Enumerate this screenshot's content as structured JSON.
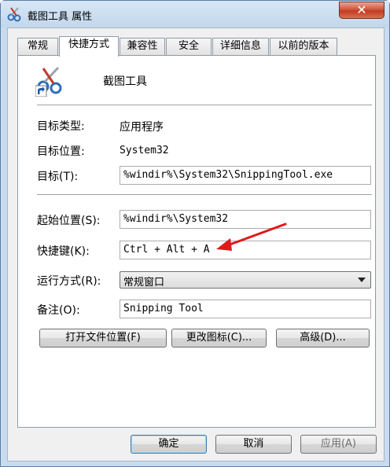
{
  "window": {
    "title": "截图工具 属性",
    "close_glyph": "✕"
  },
  "tabs": [
    {
      "label": "常规"
    },
    {
      "label": "快捷方式",
      "active": true
    },
    {
      "label": "兼容性"
    },
    {
      "label": "安全"
    },
    {
      "label": "详细信息"
    },
    {
      "label": "以前的版本"
    }
  ],
  "shortcut": {
    "app_name": "截图工具",
    "target_type_label": "目标类型:",
    "target_type_value": "应用程序",
    "target_location_label": "目标位置:",
    "target_location_value": "System32",
    "target_label": "目标(T):",
    "target_value": "%windir%\\System32\\SnippingTool.exe",
    "start_in_label": "起始位置(S):",
    "start_in_value": "%windir%\\System32",
    "hotkey_label": "快捷键(K):",
    "hotkey_value": "Ctrl + Alt + A",
    "run_label": "运行方式(R):",
    "run_value": "常规窗口",
    "comment_label": "备注(O):",
    "comment_value": "Snipping Tool"
  },
  "panel_buttons": {
    "open_location": "打开文件位置(F)",
    "change_icon": "更改图标(C)...",
    "advanced": "高级(D)..."
  },
  "dialog_buttons": {
    "ok": "确定",
    "cancel": "取消",
    "apply": "应用(A)"
  },
  "colors": {
    "annotation_arrow": "#e0191b",
    "close_button": "#c94a31"
  },
  "icons": {
    "window": "scissors-icon",
    "shortcut": "scissors-shortcut-icon"
  }
}
